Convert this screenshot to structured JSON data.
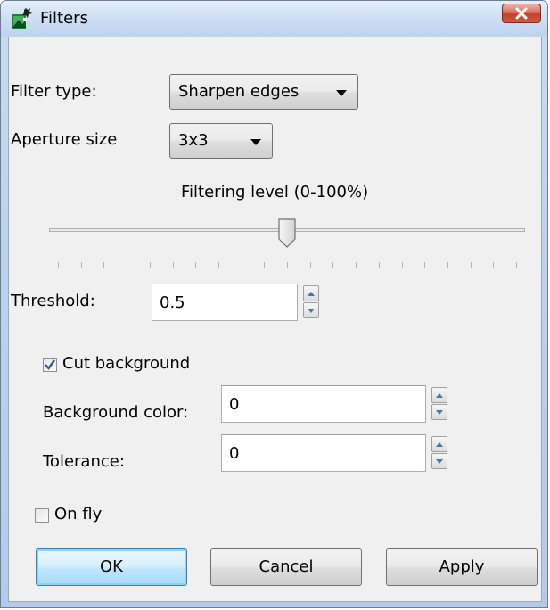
{
  "window": {
    "title": "Filters"
  },
  "filter_type": {
    "label": "Filter type:",
    "value": "Sharpen edges"
  },
  "aperture": {
    "label": "Aperture size",
    "value": "3x3"
  },
  "filtering_level": {
    "label": "Filtering level (0-100%)",
    "value_percent": 50,
    "tick_count": 21
  },
  "threshold": {
    "label": "Threshold:",
    "value": "0.5"
  },
  "cut_background": {
    "label": "Cut background",
    "checked": true
  },
  "background_color": {
    "label": "Background color:",
    "value": "0"
  },
  "tolerance": {
    "label": "Tolerance:",
    "value": "0"
  },
  "on_fly": {
    "label": "On fly",
    "checked": false
  },
  "buttons": {
    "ok": "OK",
    "cancel": "Cancel",
    "apply": "Apply"
  },
  "icons": {
    "app": "filter-app-icon",
    "close": "close-icon"
  }
}
